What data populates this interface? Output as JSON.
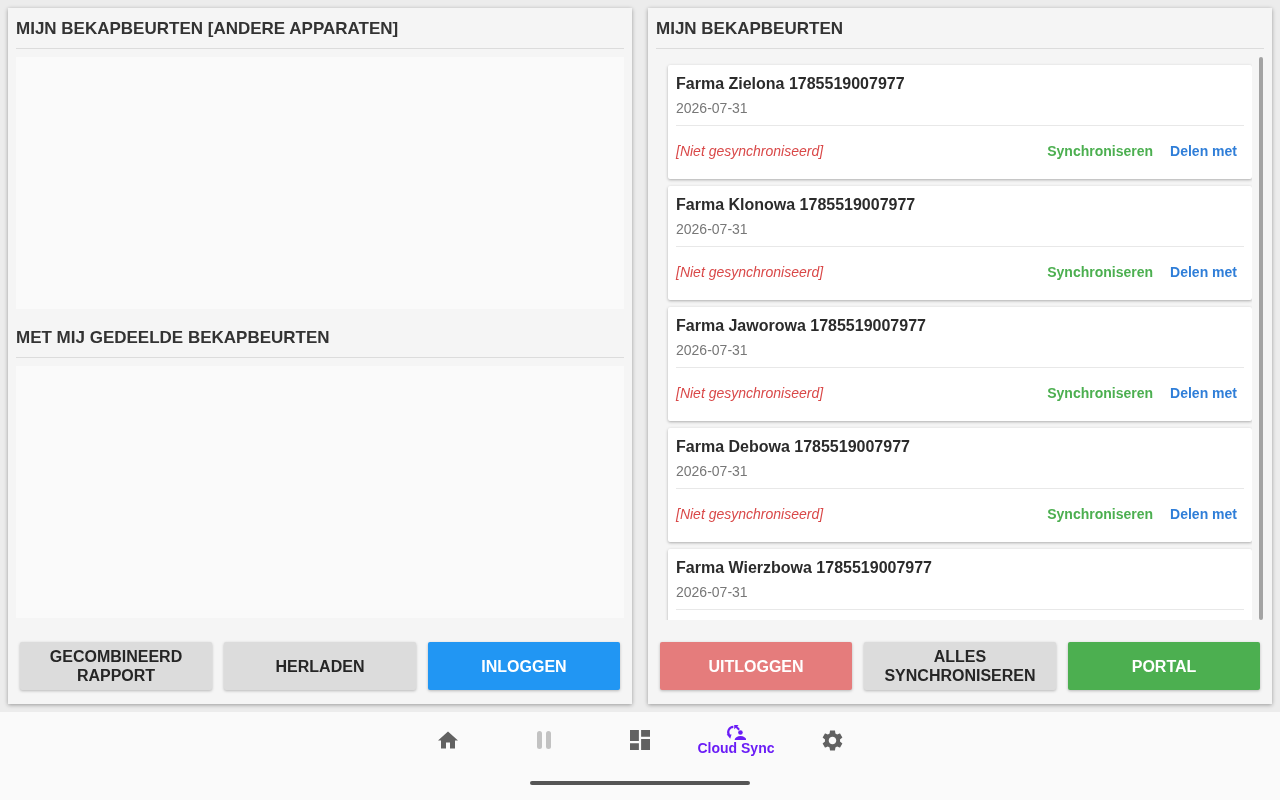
{
  "left_panel": {
    "sections": [
      {
        "title": "MIJN BEKAPBEURTEN [ANDERE APPARATEN]"
      },
      {
        "title": "MET MIJ GEDEELDE BEKAPBEURTEN"
      }
    ],
    "buttons": [
      {
        "label": "GECOMBINEERD RAPPORT",
        "kind": "neutral"
      },
      {
        "label": "HERLADEN",
        "kind": "neutral"
      },
      {
        "label": "INLOGGEN",
        "kind": "primary"
      }
    ]
  },
  "right_panel": {
    "title": "MIJN BEKAPBEURTEN",
    "items": [
      {
        "title": "Farma Zielona 1785519007977",
        "date": "2026-07-31",
        "status": "[Niet gesynchroniseerd]",
        "synced": false,
        "actions": [
          {
            "label": "Synchroniseren",
            "kind": "sync"
          },
          {
            "label": "Delen met",
            "kind": "share"
          }
        ]
      },
      {
        "title": "Farma Klonowa 1785519007977",
        "date": "2026-07-31",
        "status": "[Niet gesynchroniseerd]",
        "synced": false,
        "actions": [
          {
            "label": "Synchroniseren",
            "kind": "sync"
          },
          {
            "label": "Delen met",
            "kind": "share"
          }
        ]
      },
      {
        "title": "Farma Jaworowa 1785519007977",
        "date": "2026-07-31",
        "status": "[Niet gesynchroniseerd]",
        "synced": false,
        "actions": [
          {
            "label": "Synchroniseren",
            "kind": "sync"
          },
          {
            "label": "Delen met",
            "kind": "share"
          }
        ]
      },
      {
        "title": "Farma Debowa 1785519007977",
        "date": "2026-07-31",
        "status": "[Niet gesynchroniseerd]",
        "synced": false,
        "actions": [
          {
            "label": "Synchroniseren",
            "kind": "sync"
          },
          {
            "label": "Delen met",
            "kind": "share"
          }
        ]
      },
      {
        "title": "Farma Wierzbowa 1785519007977",
        "date": "2026-07-31"
      }
    ],
    "buttons": [
      {
        "label": "UITLOGGEN",
        "kind": "danger"
      },
      {
        "label": "ALLES SYNCHRONISEREN",
        "kind": "neutral"
      },
      {
        "label": "PORTAL",
        "kind": "success"
      }
    ]
  },
  "nav": {
    "items": [
      {
        "selected": false,
        "disabled": false
      },
      {
        "selected": false,
        "disabled": true
      },
      {
        "selected": false,
        "disabled": false
      },
      {
        "label": "Cloud Sync",
        "selected": true,
        "disabled": false
      },
      {
        "selected": false,
        "disabled": false
      }
    ]
  }
}
